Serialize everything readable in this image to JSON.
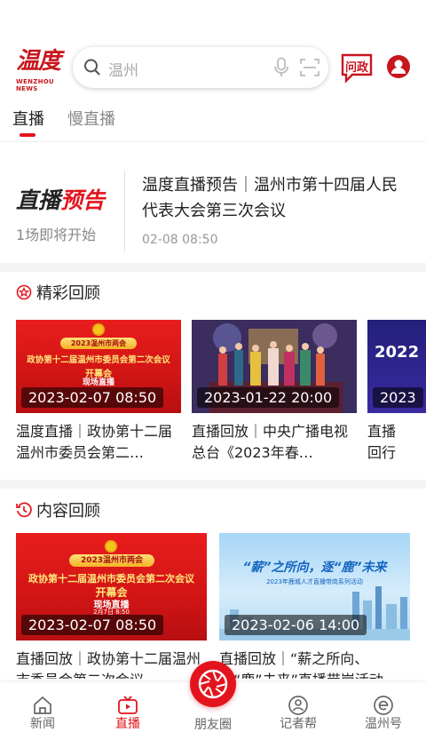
{
  "header": {
    "logo_cn": "温度",
    "logo_en": "WENZHOU NEWS",
    "search_placeholder": "温州",
    "ask_label": "问政"
  },
  "tabs": [
    {
      "label": "直播",
      "active": true
    },
    {
      "label": "慢直播",
      "active": false
    }
  ],
  "preview": {
    "brand_black": "直播",
    "brand_red": "预告",
    "subtitle": "1场即将开始",
    "title": "温度直播预告｜温州市第十四届人民代表大会第三次会议",
    "time": "02-08  08:50"
  },
  "sections": {
    "highlights": {
      "title": "精彩回顾",
      "cards": [
        {
          "timestamp": "2023-02-07  08:50",
          "title": "温度直播｜政协第十二届温州市委员会第二…",
          "banner_top": "2023温州市两会",
          "banner_main": "政协第十二届温州市委员会第二次会议",
          "banner_sub": "开幕会",
          "banner_tag": "现场直播"
        },
        {
          "timestamp": "2023-01-22  20:00",
          "title": "直播回放｜中央广播电视总台《2023年春…"
        },
        {
          "timestamp": "2023",
          "title": "直播回行业职",
          "banner_year": "2022"
        }
      ]
    },
    "content": {
      "title": "内容回顾",
      "cards": [
        {
          "timestamp": "2023-02-07  08:50",
          "title": "直播回放｜政协第十二届温州市委员会第二次会议",
          "banner_top": "2023温州市两会",
          "banner_main": "政协第十二届温州市委员会第二次会议",
          "banner_sub": "开幕会",
          "banner_tag": "现场直播",
          "banner_date": "2月7日 8:50"
        },
        {
          "timestamp": "2023-02-06  14:00",
          "title": "直播回放｜“薪之所向、逐“鹿”未来”直播带岗活动",
          "banner_main": "“薪”之所向，逐“鹿”未来",
          "banner_sub": "2023年鹿城人才直播带岗系列活动"
        }
      ]
    }
  },
  "bottom_nav": [
    {
      "label": "新闻",
      "icon": "home-icon",
      "active": false
    },
    {
      "label": "直播",
      "icon": "tv-icon",
      "active": true
    },
    {
      "label": "朋友圈",
      "icon": "shutter-icon",
      "active": false
    },
    {
      "label": "记者帮",
      "icon": "reporter-icon",
      "active": false
    },
    {
      "label": "温州号",
      "icon": "e-icon",
      "active": false
    }
  ],
  "colors": {
    "brand_red": "#e3141d",
    "logo_red": "#c8161d",
    "text_dark": "#222222",
    "text_gray": "#888888",
    "divider": "#f4f4f4"
  }
}
